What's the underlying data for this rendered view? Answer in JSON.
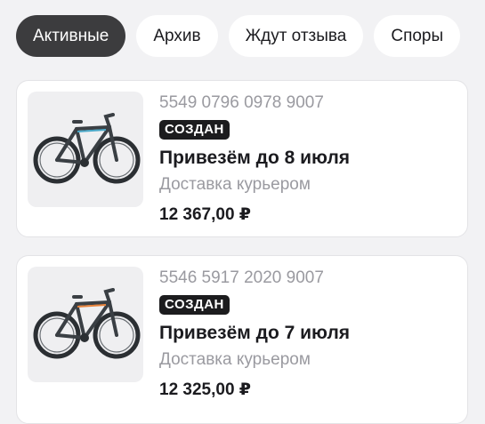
{
  "tabs": [
    {
      "label": "Активные",
      "active": true
    },
    {
      "label": "Архив",
      "active": false
    },
    {
      "label": "Ждут отзыва",
      "active": false
    },
    {
      "label": "Споры",
      "active": false
    }
  ],
  "orders": [
    {
      "number": "5549 0796 0978 9007",
      "status": "СОЗДАН",
      "delivery_title": "Привезём до 8 июля",
      "delivery_method": "Доставка курьером",
      "price": "12 367,00 ₽",
      "image_icon": "bicycle-icon",
      "accent_color": "#4aa8c8"
    },
    {
      "number": "5546 5917 2020 9007",
      "status": "СОЗДАН",
      "delivery_title": "Привезём до 7 июля",
      "delivery_method": "Доставка курьером",
      "price": "12 325,00 ₽",
      "image_icon": "bicycle-icon",
      "accent_color": "#e8823a"
    }
  ]
}
